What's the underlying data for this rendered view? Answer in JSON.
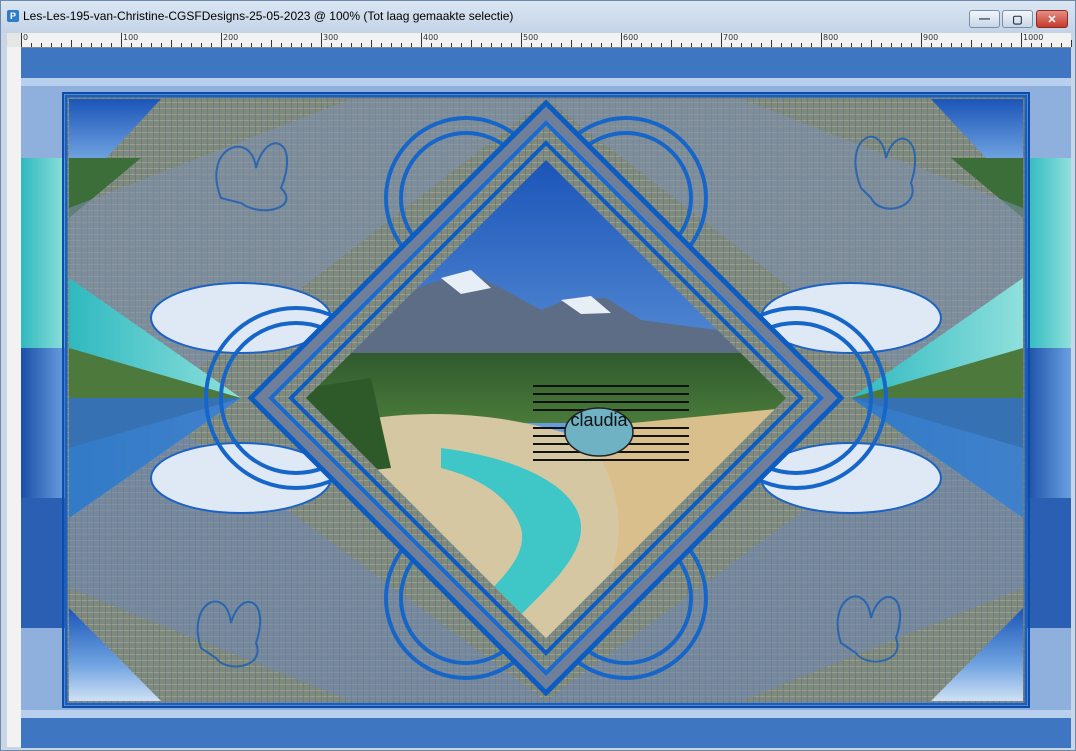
{
  "window": {
    "title": "Les-Les-195-van-Christine-CGSFDesigns-25-05-2023 @ 100% (Tot laag gemaakte selectie)",
    "app_icon": "P",
    "minimize_icon": "minimize-icon",
    "maximize_icon": "maximize-icon",
    "close_icon": "close-icon"
  },
  "ruler": {
    "labels": [
      "0",
      "100",
      "200",
      "300",
      "400",
      "500",
      "600",
      "700",
      "800",
      "900",
      "1000"
    ]
  },
  "artwork": {
    "watermark_text": "claudia",
    "colors": {
      "frame_blue": "#1f6fc9",
      "light_blue": "#a9c3e8",
      "turquoise": "#3ec7c8",
      "sand": "#d9c08e",
      "mesh": "#8e9078",
      "sky": "#2b6fcf"
    }
  }
}
